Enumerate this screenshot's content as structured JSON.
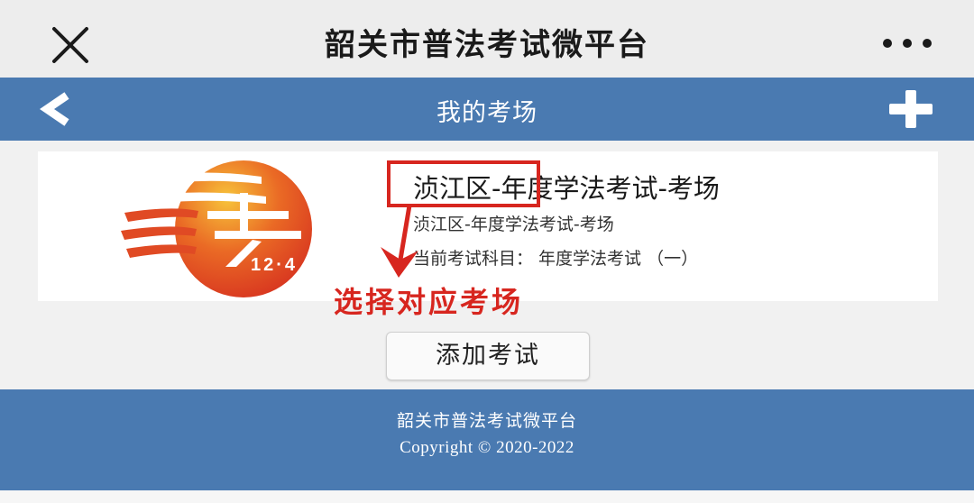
{
  "topbar": {
    "title": "韶关市普法考试微平台",
    "close_icon": "close-icon",
    "more_icon": "more-icon"
  },
  "navbar": {
    "title": "我的考场",
    "back_icon": "chevron-left-icon",
    "add_icon": "plus-icon"
  },
  "exam_card": {
    "logo_icon": "law-day-logo",
    "logo_text": "12·4",
    "title": "浈江区-年度学法考试-考场",
    "subtitle": "浈江区-年度学法考试-考场",
    "subject": "当前考试科目： 年度学法考试 （一）"
  },
  "annotation": {
    "text": "选择对应考场",
    "color": "#d7261f"
  },
  "add_exam_button": {
    "label": "添加考试"
  },
  "footer": {
    "name": "韶关市普法考试微平台",
    "copyright": "Copyright © 2020-2022"
  },
  "colors": {
    "brand_blue": "#4a7ab1",
    "annotation_red": "#d7261f"
  }
}
